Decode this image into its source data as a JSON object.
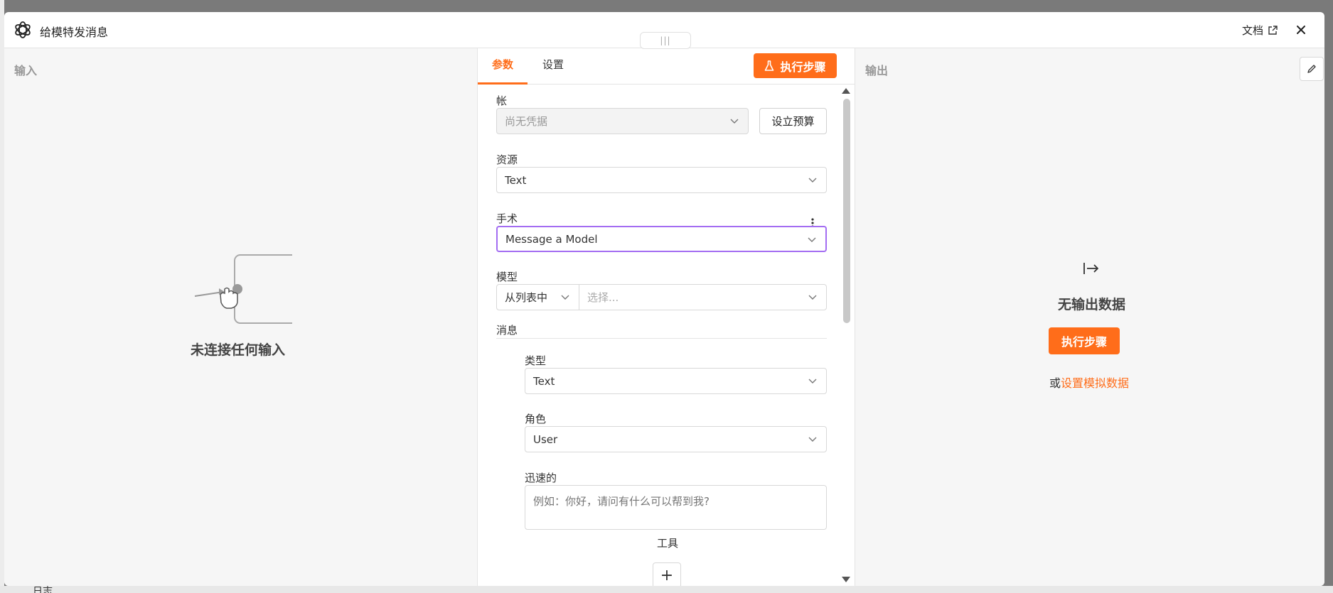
{
  "window": {
    "title": "给模特发消息",
    "docs_label": "文档"
  },
  "input_panel": {
    "label": "输入",
    "empty_message": "未连接任何输入"
  },
  "tabs": [
    {
      "label": "参数",
      "active": true
    },
    {
      "label": "设置",
      "active": false
    }
  ],
  "execute_button": "执行步骤",
  "params": {
    "account": {
      "label": "帐",
      "value": "尚无凭据",
      "disabled": true,
      "budget_button": "设立预算"
    },
    "resource": {
      "label": "资源",
      "value": "Text"
    },
    "operation": {
      "label": "手术",
      "value": "Message a Model"
    },
    "model": {
      "label": "模型",
      "mode_value": "从列表中",
      "placeholder": "选择..."
    },
    "messages": {
      "label": "消息",
      "type": {
        "label": "类型",
        "value": "Text"
      },
      "role": {
        "label": "角色",
        "value": "User"
      },
      "prompt": {
        "label": "迅速的",
        "placeholder": "例如：你好，请问有什么可以帮到我?"
      }
    },
    "tools_label": "工具",
    "add_tool_symbol": "+"
  },
  "output_panel": {
    "label": "输出",
    "empty_message": "无输出数据",
    "execute_button": "执行步骤",
    "or_text": "或",
    "mock_link": "设置模拟数据"
  },
  "background": {
    "bottom_text": "日志"
  },
  "colors": {
    "accent": "#ff6d1a",
    "focus_border": "#a36df2",
    "panel_bg": "#f6f6f6"
  }
}
